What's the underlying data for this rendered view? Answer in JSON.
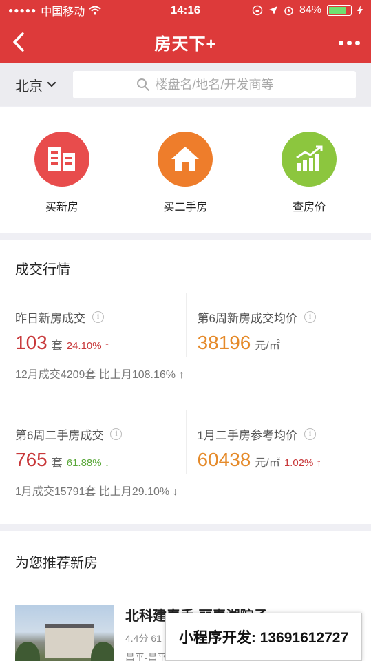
{
  "status_bar": {
    "carrier": "中国移动",
    "time": "14:16",
    "battery": "84%",
    "battery_level": 0.84
  },
  "nav": {
    "title": "房天下+"
  },
  "search": {
    "city": "北京",
    "placeholder": "楼盘名/地名/开发商等"
  },
  "quick_entries": [
    {
      "label": "买新房",
      "icon": "buildings-icon",
      "color": "#e84c4c"
    },
    {
      "label": "买二手房",
      "icon": "house-icon",
      "color": "#ee7d2b"
    },
    {
      "label": "查房价",
      "icon": "bar-chart-icon",
      "color": "#8cc63e"
    }
  ],
  "market": {
    "title": "成交行情",
    "block1": {
      "left": {
        "label": "昨日新房成交",
        "value": "103",
        "unit": "套",
        "change": "24.10% ↑"
      },
      "right": {
        "label": "第6周新房成交均价",
        "value": "38196",
        "unit": "元/㎡"
      },
      "foot": "12月成交4209套 比上月108.16% ↑"
    },
    "block2": {
      "left": {
        "label": "第6周二手房成交",
        "value": "765",
        "unit": "套",
        "change": "61.88% ↓"
      },
      "right": {
        "label": "1月二手房参考均价",
        "value": "60438",
        "unit": "元/㎡",
        "change": "1.02% ↑"
      },
      "foot": "1月成交15791套 比上月29.10% ↓"
    }
  },
  "recommend": {
    "title": "为您推荐新房",
    "listing": {
      "name": "北科建春手·丽春湖院子",
      "rating": "4.4分 61",
      "location": "昌平-昌平"
    }
  },
  "watermark": "小程序开发: 13691612727"
}
